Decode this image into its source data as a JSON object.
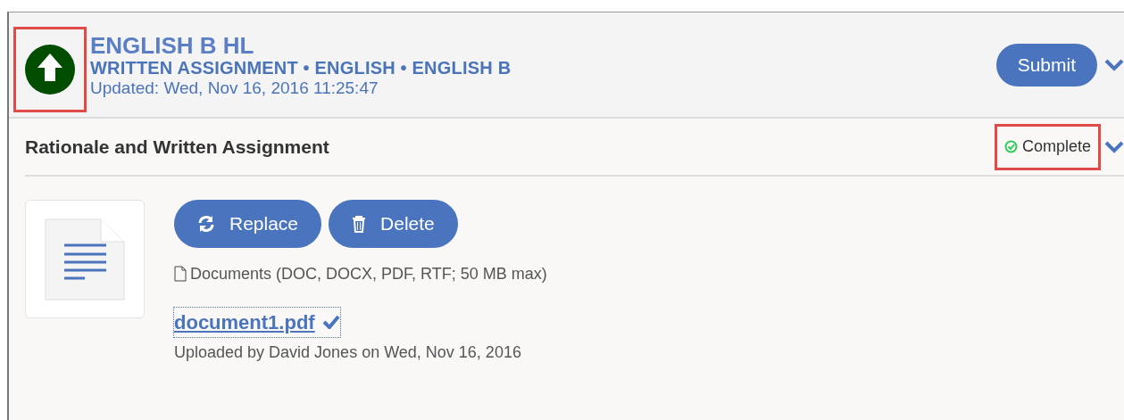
{
  "header": {
    "title": "ENGLISH B HL",
    "subtitle": "WRITTEN ASSIGNMENT • ENGLISH • ENGLISH B",
    "updated": "Updated: Wed, Nov 16, 2016 11:25:47",
    "status_highlighted": true,
    "submit_label": "Submit"
  },
  "section": {
    "title": "Rationale and Written Assignment",
    "status": "Complete",
    "status_highlighted": true
  },
  "file_actions": [
    {
      "kind": "replace",
      "label": "Replace"
    },
    {
      "kind": "delete",
      "label": "Delete"
    }
  ],
  "accepted_types": "Documents (DOC, DOCX, PDF, RTF; 50 MB max)",
  "file": {
    "name": "document1.pdf",
    "verified": true,
    "uploaded": "Uploaded by David Jones on Wed, Nov 16, 2016"
  }
}
